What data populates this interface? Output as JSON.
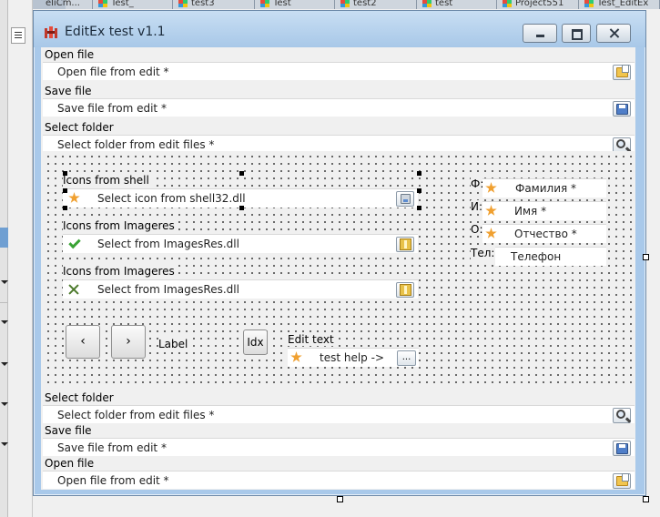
{
  "ide": {
    "tabs": [
      "eliCm...",
      "Test_",
      "test3",
      "Test",
      "test2",
      "test",
      "Project551",
      "Test_EditEx"
    ]
  },
  "window": {
    "title": "EditEx test v1.1",
    "icon": "app-logo-icon"
  },
  "top_fields": [
    {
      "label": "Open file",
      "value": "Open file from edit *",
      "button_icon": "open-file-icon"
    },
    {
      "label": "Save file",
      "value": "Save file from edit *",
      "button_icon": "save-file-icon"
    },
    {
      "label": "Select folder",
      "value": "Select folder from edit files *",
      "button_icon": "magnifier-icon"
    }
  ],
  "panel": {
    "groups": [
      {
        "label": "Icons from shell",
        "value": "Select icon from shell32.dll",
        "icon": "star-icon",
        "button_icon": "disk-icon"
      },
      {
        "label": "Icons from Imageres",
        "value": "Select from ImagesRes.dll",
        "icon": "check-icon",
        "button_icon": "folder-icon"
      },
      {
        "label": "Icons from Imageres",
        "value": "Select from ImagesRes.dll",
        "icon": "cross-icon",
        "button_icon": "folder-icon"
      }
    ],
    "fio": [
      {
        "prefix": "Ф:",
        "value": "Фамилия *"
      },
      {
        "prefix": "И:",
        "value": "Имя *"
      },
      {
        "prefix": "О:",
        "value": "Отчество *"
      },
      {
        "prefix": "Тел:",
        "value": "Телефон"
      }
    ],
    "prev_button": "‹",
    "next_button": "›",
    "label": "Label",
    "idx_button": "Idx",
    "edit_text": {
      "label": "Edit text",
      "value": "test help  ->",
      "button": "..."
    }
  },
  "bottom_fields": [
    {
      "label": "Select folder",
      "value": "Select folder from edit files *",
      "button_icon": "magnifier-icon"
    },
    {
      "label": "Save file",
      "value": "Save file from edit *",
      "button_icon": "save-file-icon"
    },
    {
      "label": "Open file",
      "value": "Open file from edit *",
      "button_icon": "open-file-icon"
    }
  ],
  "colors": {
    "titlebar": "#a8c8e8",
    "client": "#f0f0f0",
    "star": "#f0a030",
    "check": "#3aa335"
  }
}
